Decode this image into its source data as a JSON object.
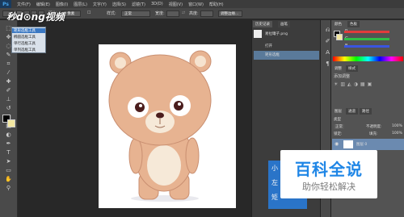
{
  "menu": {
    "app_icon": "Ps",
    "items": [
      "文件(F)",
      "编辑(E)",
      "图像(I)",
      "图层(L)",
      "文字(Y)",
      "选择(S)",
      "滤镜(T)",
      "3D(D)",
      "视图(V)",
      "窗口(W)",
      "帮助(H)"
    ]
  },
  "options_bar": {
    "feather_label": "羽化:",
    "feather_value": "0 像素",
    "style_label": "样式:",
    "style_value": "正常",
    "width_label": "宽度:",
    "height_label": "高度:",
    "refine_button": "调整边缘..."
  },
  "marquee_flyout": {
    "items": [
      "矩形选框工具",
      "椭圆选框工具",
      "单行选框工具",
      "单列选框工具"
    ],
    "shortcut": "M",
    "selected_index": 0
  },
  "watermark": "秒d⊙ng视频",
  "history_panel": {
    "tabs": [
      "历史记录",
      "画笔"
    ],
    "doc_name": "易拉罐子.png",
    "states": [
      "打开",
      "矩形选框"
    ]
  },
  "color_panel": {
    "tabs": [
      "颜色",
      "色板"
    ],
    "channels": [
      "R",
      "G",
      "B"
    ],
    "colors": {
      "fg": "#000000",
      "bg": "#f3e7a1",
      "r": "#e23b3b",
      "g": "#2fbf45",
      "b": "#3a55e0"
    }
  },
  "adjust_panel": {
    "tabs": [
      "调整",
      "样式"
    ],
    "title": "添加调整"
  },
  "layers_panel": {
    "tabs": [
      "图层",
      "通道",
      "路径"
    ],
    "kind_label": "类型",
    "blend_mode": "正常",
    "opacity_label": "不透明度:",
    "opacity_value": "100%",
    "lock_label": "锁定:",
    "fill_label": "填充:",
    "fill_value": "100%",
    "layer_name": "图层 0"
  },
  "blue_overlay": {
    "lines": [
      "小",
      "左",
      "矩"
    ]
  },
  "baike": {
    "title": "百科全说",
    "subtitle": "助你轻松解决"
  }
}
